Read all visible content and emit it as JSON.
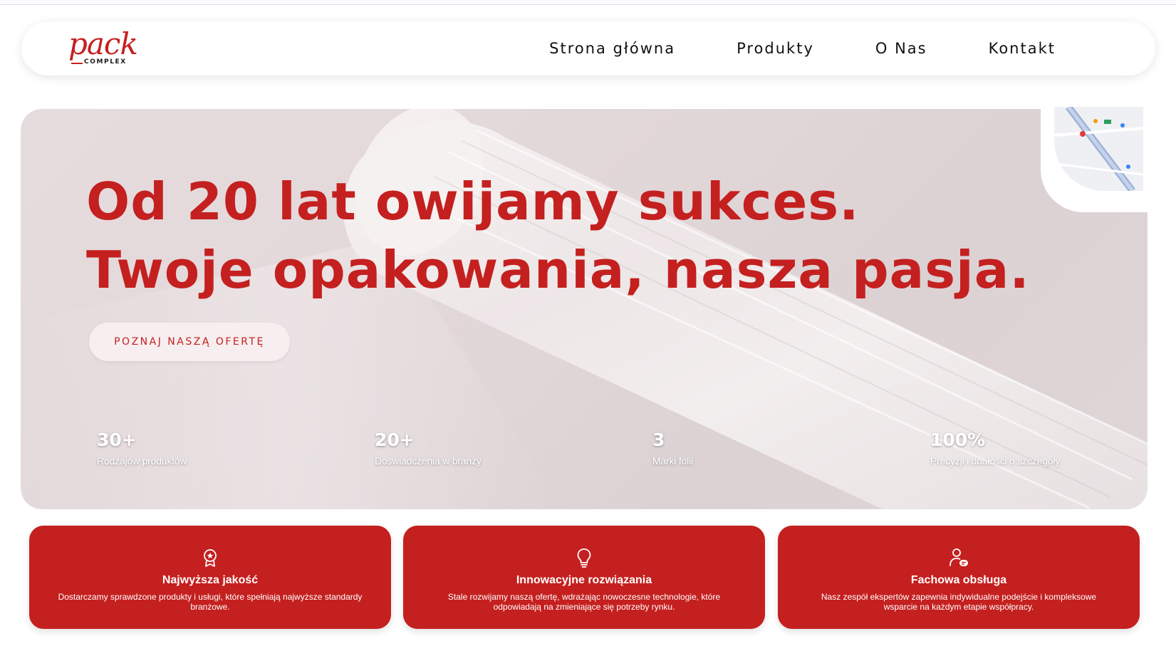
{
  "brand": {
    "logo_main": "pack",
    "logo_sub": "COMPLEX",
    "accent_color": "#c4201f"
  },
  "nav": {
    "items": [
      {
        "label": "Strona główna"
      },
      {
        "label": "Produkty"
      },
      {
        "label": "O Nas"
      },
      {
        "label": "Kontakt"
      }
    ]
  },
  "hero": {
    "title_line1": "Od 20 lat owijamy sukces.",
    "title_line2": "Twoje opakowania, nasza pasja.",
    "cta_label": "POZNAJ NASZĄ OFERTĘ",
    "stats": [
      {
        "value": "30+",
        "label": "Rodzajów produktów"
      },
      {
        "value": "20+",
        "label": "Doświadczenia w branży"
      },
      {
        "value": "3",
        "label": "Marki folii"
      },
      {
        "value": "100%",
        "label": "Precyzji i dbałości o szczegóły"
      }
    ]
  },
  "features": [
    {
      "icon": "award-icon",
      "title": "Najwyższa jakość",
      "text": "Dostarczamy sprawdzone produkty i usługi, które spełniają najwyższe standardy branżowe."
    },
    {
      "icon": "lightbulb-icon",
      "title": "Innowacyjne rozwiązania",
      "text": "Stale rozwijamy naszą ofertę, wdrażając nowoczesne technologie, które odpowiadają na zmieniające się potrzeby rynku."
    },
    {
      "icon": "support-user-icon",
      "title": "Fachowa obsługa",
      "text": "Nasz zespół ekspertów zapewnia indywidualne podejście i kompleksowe wsparcie na każdym etapie współpracy."
    }
  ]
}
